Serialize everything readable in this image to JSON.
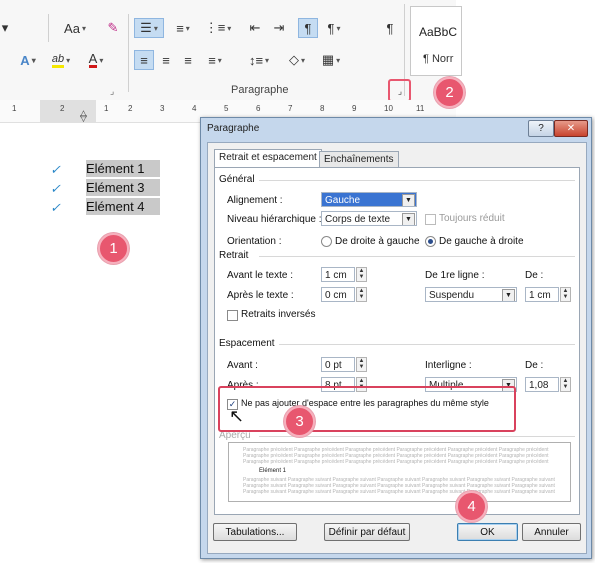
{
  "ribbon": {
    "font_size_label": "Aa",
    "font_size_dd": "▾",
    "eraser_icon": "✎",
    "bullets_icon": "☰",
    "numbering_icon": "≡",
    "multilevel_icon": "⋮≡",
    "decrease_indent_icon": "⇤",
    "increase_indent_icon": "⇥",
    "ltr_icon": "¶",
    "rtl_icon": "¶",
    "pilcrow_icon": "¶",
    "text_effects_label": "A",
    "highlight_label": "ab",
    "font_color_label": "A",
    "align_left_icon": "≡",
    "center_icon": "≡",
    "align_right_icon": "≡",
    "justify_icon": "≡",
    "line_spacing_icon": "↕≡",
    "shading_icon": "◇",
    "borders_icon": "▦",
    "launcher_icon": "⌟",
    "group_label": "Paragraphe",
    "styles_preview": "AaBbC",
    "styles_normal": "¶ Norr",
    "highlight_color": "#f5e800",
    "font_color": "#d01818"
  },
  "ruler": {
    "numbers": [
      "1",
      "2",
      "1",
      "2",
      "3",
      "4",
      "5",
      "6",
      "7",
      "8",
      "9",
      "10",
      "11"
    ]
  },
  "document": {
    "items": [
      "Elément 1",
      "Elément 3",
      "Elément 4"
    ],
    "bullet_glyph": "✓",
    "bullet_color": "#2b88c8"
  },
  "badges": {
    "b1": "1",
    "b2": "2",
    "b3": "3",
    "b4": "4",
    "color": "#e8576f"
  },
  "dialog": {
    "title": "Paragraphe",
    "help_label": "?",
    "close_label": "✕",
    "tabs": [
      "Retrait et espacement",
      "Enchaînements"
    ],
    "general": {
      "section": "Général",
      "alignment_label": "Alignement :",
      "alignment_value": "Gauche",
      "level_label": "Niveau hiérarchique :",
      "level_value": "Corps de texte",
      "collapsed_label": "Toujours réduit",
      "orientation_label": "Orientation :",
      "rtl_label": "De droite à gauche",
      "ltr_label": "De gauche à droite"
    },
    "retrait": {
      "section": "Retrait",
      "before_label": "Avant le texte :",
      "before_value": "1 cm",
      "after_label": "Après le texte :",
      "after_value": "0 cm",
      "first_line_label": "De 1re ligne :",
      "first_line_value": "Suspendu",
      "de_label": "De :",
      "de_value": "1 cm",
      "mirror_label": "Retraits inversés"
    },
    "espacement": {
      "section": "Espacement",
      "before_label": "Avant :",
      "before_value": "0 pt",
      "after_label": "Après :",
      "after_value": "8 pt",
      "interline_label": "Interligne :",
      "interline_value": "Multiple",
      "de_label": "De :",
      "de_value": "1,08",
      "no_space_label": "Ne pas ajouter d'espace entre les paragraphes du même style"
    },
    "apercu": {
      "section": "Aperçu",
      "prev_text": "Paragraphe précédent Paragraphe précédent Paragraphe précédent Paragraphe précédent Paragraphe précédent Paragraphe précédent",
      "item_text": "Elément 1",
      "next_text": "Paragraphe suivant Paragraphe suivant Paragraphe suivant Paragraphe suivant Paragraphe suivant Paragraphe suivant Paragraphe suivant"
    },
    "buttons": {
      "tabs": "Tabulations...",
      "default": "Définir par défaut",
      "ok": "OK",
      "cancel": "Annuler"
    }
  }
}
